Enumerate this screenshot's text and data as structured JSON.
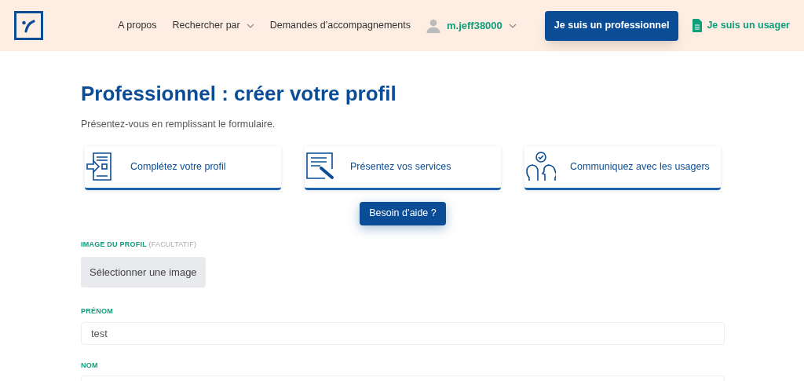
{
  "header": {
    "nav": [
      {
        "label": "A propos",
        "dropdown": false
      },
      {
        "label": "Rechercher par",
        "dropdown": true
      },
      {
        "label": "Demandes d’accompagnements",
        "dropdown": false
      }
    ],
    "user": {
      "name": "m.jeff38000"
    },
    "pro_button": "Je suis un professionnel",
    "user_link": "Je suis un usager"
  },
  "title": "Professionnel : créer votre profil",
  "subtitle": "Présentez-vous en remplissant le formulaire.",
  "steps": [
    {
      "kind": "profile",
      "label": "Complétez votre profil"
    },
    {
      "kind": "services",
      "label": "Présentez vos services"
    },
    {
      "kind": "communicate",
      "label": "Communiquez avec les usagers"
    }
  ],
  "help_button": "Besoin d’aide ?",
  "image_field": {
    "label": "IMAGE DU PROFIL",
    "hint": "(FACULTATIF)",
    "button": "Sélectionner une image"
  },
  "fields": [
    {
      "label": "PRÉNOM",
      "value": "test"
    },
    {
      "label": "NOM"
    }
  ]
}
